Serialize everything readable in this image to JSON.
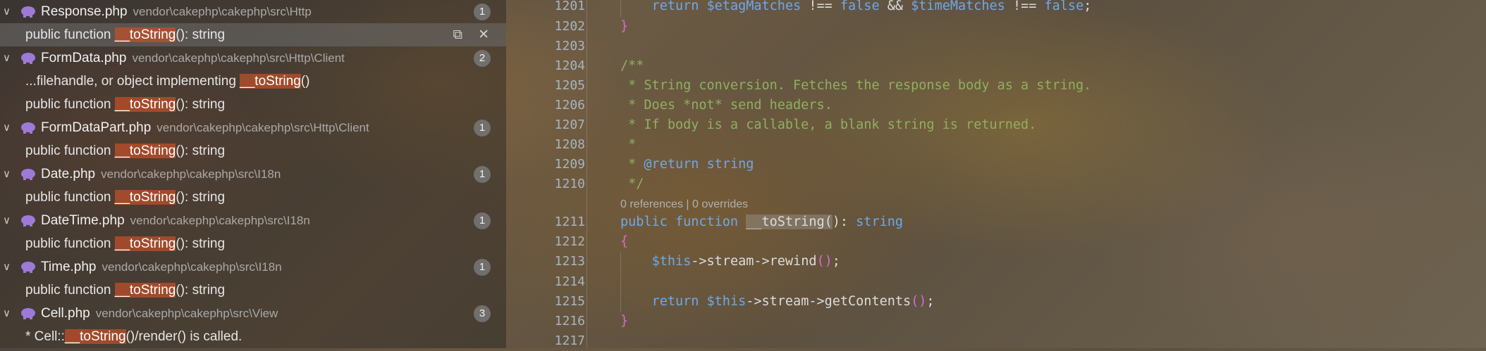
{
  "results": {
    "files": [
      {
        "name": "Response.php",
        "path": "vendor\\cakephp\\cakephp\\src\\Http",
        "count": "1",
        "matches": [
          {
            "pre": "public function ",
            "hl": "__toString",
            "post": "(): string",
            "selected": true
          }
        ]
      },
      {
        "name": "FormData.php",
        "path": "vendor\\cakephp\\cakephp\\src\\Http\\Client",
        "count": "2",
        "matches": [
          {
            "pre": "...filehandle, or object implementing ",
            "hl": "__toString",
            "post": "()"
          },
          {
            "pre": "public function ",
            "hl": "__toString",
            "post": "(): string"
          }
        ]
      },
      {
        "name": "FormDataPart.php",
        "path": "vendor\\cakephp\\cakephp\\src\\Http\\Client",
        "count": "1",
        "matches": [
          {
            "pre": "public function ",
            "hl": "__toString",
            "post": "(): string"
          }
        ]
      },
      {
        "name": "Date.php",
        "path": "vendor\\cakephp\\cakephp\\src\\I18n",
        "count": "1",
        "matches": [
          {
            "pre": "public function ",
            "hl": "__toString",
            "post": "(): string"
          }
        ]
      },
      {
        "name": "DateTime.php",
        "path": "vendor\\cakephp\\cakephp\\src\\I18n",
        "count": "1",
        "matches": [
          {
            "pre": "public function ",
            "hl": "__toString",
            "post": "(): string"
          }
        ]
      },
      {
        "name": "Time.php",
        "path": "vendor\\cakephp\\cakephp\\src\\I18n",
        "count": "1",
        "matches": [
          {
            "pre": "public function ",
            "hl": "__toString",
            "post": "(): string"
          }
        ]
      },
      {
        "name": "Cell.php",
        "path": "vendor\\cakephp\\cakephp\\src\\View",
        "count": "3",
        "matches": [
          {
            "pre": "* Cell::",
            "hl": "__toString",
            "post": "()/render() is called."
          }
        ]
      }
    ],
    "actions": {
      "replace_icon": "replace-icon",
      "dismiss_icon": "close-icon"
    }
  },
  "editor": {
    "codelens": "0 references | 0 overrides",
    "lines": [
      {
        "n": "1201",
        "t": "    return $etagMatches !== false && $timeMatches !== false;"
      },
      {
        "n": "1202",
        "t": "}"
      },
      {
        "n": "1203",
        "t": ""
      },
      {
        "n": "1204",
        "t": "/**"
      },
      {
        "n": "1205",
        "t": " * String conversion. Fetches the response body as a string."
      },
      {
        "n": "1206",
        "t": " * Does *not* send headers."
      },
      {
        "n": "1207",
        "t": " * If body is a callable, a blank string is returned."
      },
      {
        "n": "1208",
        "t": " *"
      },
      {
        "n": "1209",
        "t": " * @return string"
      },
      {
        "n": "1210",
        "t": " */"
      },
      {
        "n": "1211",
        "t": "public function __toString(): string"
      },
      {
        "n": "1212",
        "t": "{"
      },
      {
        "n": "1213",
        "t": "    $this->stream->rewind();"
      },
      {
        "n": "1214",
        "t": ""
      },
      {
        "n": "1215",
        "t": "    return $this->stream->getContents();"
      },
      {
        "n": "1216",
        "t": "}"
      },
      {
        "n": "1217",
        "t": ""
      }
    ]
  },
  "colors": {
    "keyword": "#6fa8e8",
    "comment": "#8fb060",
    "highlight": "#c85028",
    "badge": "#787878"
  }
}
